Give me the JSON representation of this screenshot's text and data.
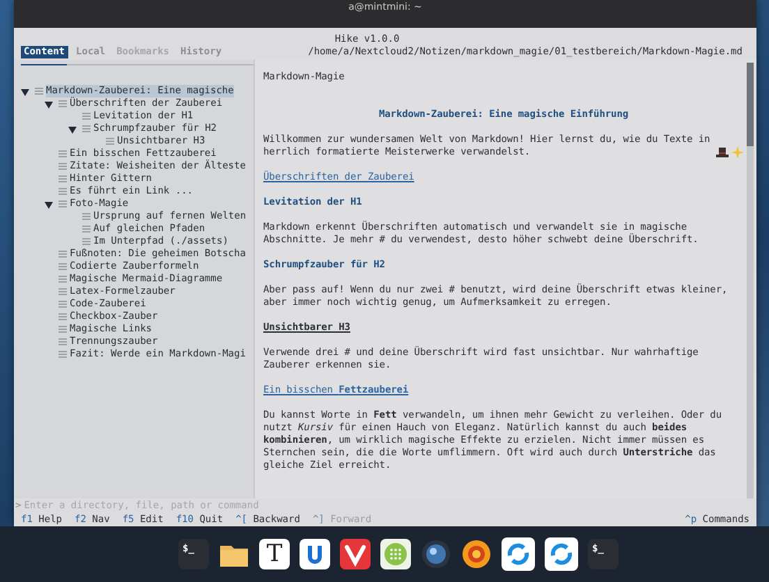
{
  "window": {
    "title": "a@mintmini: ~"
  },
  "app": {
    "name": "Hike v1.0.0",
    "path": "/home/a/Nextcloud2/Notizen/markdown_magie/01_testbereich/Markdown-Magie.md"
  },
  "tabs": [
    {
      "label": "Content",
      "selected": true,
      "disabled": false
    },
    {
      "label": "Local",
      "selected": false,
      "disabled": false
    },
    {
      "label": "Bookmarks",
      "selected": false,
      "disabled": true
    },
    {
      "label": "History",
      "selected": false,
      "disabled": false
    }
  ],
  "outline": [
    {
      "label": "Markdown-Zauberei: Eine magische",
      "selected": true,
      "expanded": true,
      "children": [
        {
          "label": "Überschriften der Zauberei",
          "selected": false,
          "expanded": true,
          "children": [
            {
              "label": "Levitation der H1",
              "selected": false
            },
            {
              "label": "Schrumpfzauber für H2",
              "selected": false,
              "expanded": true,
              "children": [
                {
                  "label": "Unsichtbarer H3",
                  "selected": false
                }
              ]
            }
          ]
        },
        {
          "label": "Ein bisschen Fettzauberei",
          "selected": false
        },
        {
          "label": "Zitate: Weisheiten der Älteste",
          "selected": false
        },
        {
          "label": "Hinter Gittern",
          "selected": false
        },
        {
          "label": "Es führt ein Link ...",
          "selected": false
        },
        {
          "label": "Foto-Magie",
          "selected": false,
          "expanded": true,
          "children": [
            {
              "label": "Ursprung auf fernen Welten",
              "selected": false
            },
            {
              "label": "Auf gleichen Pfaden",
              "selected": false
            },
            {
              "label": "Im Unterpfad (./assets)",
              "selected": false
            }
          ]
        },
        {
          "label": "Fußnoten: Die geheimen Botscha",
          "selected": false
        },
        {
          "label": "Codierte Zauberformeln",
          "selected": false
        },
        {
          "label": "Magische Mermaid-Diagramme",
          "selected": false
        },
        {
          "label": "Latex-Formelzauber",
          "selected": false
        },
        {
          "label": "Code-Zauberei",
          "selected": false
        },
        {
          "label": "Checkbox-Zauber",
          "selected": false
        },
        {
          "label": "Magische Links",
          "selected": false
        },
        {
          "label": "Trennungszauber",
          "selected": false
        },
        {
          "label": "Fazit: Werde ein Markdown-Magi",
          "selected": false
        }
      ]
    }
  ],
  "document": [
    {
      "kind": "filename",
      "text": "Markdown-Magie"
    },
    {
      "kind": "h1",
      "text": "Markdown-Zauberei: Eine magische Einführung"
    },
    {
      "kind": "intro",
      "text": "Willkommen zur wundersamen Welt von Markdown! Hier lernst du, wie du Texte in herrlich formatierte Meisterwerke verwandelst."
    },
    {
      "kind": "h2",
      "text": "Überschriften der Zauberei"
    },
    {
      "kind": "h3",
      "text": "Levitation der H1"
    },
    {
      "kind": "paragraph",
      "text": "Markdown erkennt Überschriften automatisch und verwandelt sie in magische Abschnitte. Je mehr # du verwendest, desto höher schwebt deine Überschrift."
    },
    {
      "kind": "h3",
      "text": "Schrumpfzauber für H2"
    },
    {
      "kind": "paragraph",
      "text": "Aber pass auf! Wenn du nur zwei # benutzt, wird deine Überschrift etwas kleiner, aber immer noch wichtig genug, um Aufmerksamkeit zu erregen."
    },
    {
      "kind": "h4",
      "text": "Unsichtbarer H3"
    },
    {
      "kind": "paragraph",
      "text": "Verwende drei # und deine Überschrift wird fast unsichtbar. Nur wahrhaftige Zauberer erkennen sie."
    },
    {
      "kind": "h2",
      "text": "Ein bisschen **Fettzauberei**"
    },
    {
      "kind": "paragraph",
      "text": "Du kannst Worte in **Fett** verwandeln, um ihnen mehr Gewicht zu verleihen. Oder du nutzt *Kursiv* für einen Hauch von Eleganz. Natürlich kannst du auch **beides kombinieren**, um wirklich magische Effekte zu erzielen. Nicht immer müssen es Sternchen sein, die die Worte umflimmern. Oft wird auch durch **Unterstriche** das gleiche Ziel erreicht."
    }
  ],
  "command": {
    "prompt": ">",
    "placeholder": "Enter a directory, file, path or command"
  },
  "keys": [
    {
      "key": "f1",
      "label": "Help",
      "disabled": false
    },
    {
      "key": "f2",
      "label": "Nav",
      "disabled": false
    },
    {
      "key": "f5",
      "label": "Edit",
      "disabled": false
    },
    {
      "key": "f10",
      "label": "Quit",
      "disabled": false
    },
    {
      "key": "^[",
      "label": "Backward",
      "disabled": false
    },
    {
      "key": "^]",
      "label": "Forward",
      "disabled": true
    }
  ],
  "keys_right": [
    {
      "key": "^p",
      "label": "Commands",
      "disabled": false
    }
  ],
  "dock": [
    {
      "kind": "terminal",
      "glyph": "$_"
    },
    {
      "kind": "folder"
    },
    {
      "kind": "letter",
      "glyph": "T"
    },
    {
      "kind": "u-app"
    },
    {
      "kind": "vivaldi"
    },
    {
      "kind": "grid"
    },
    {
      "kind": "lens"
    },
    {
      "kind": "flower"
    },
    {
      "kind": "sync"
    },
    {
      "kind": "sync"
    },
    {
      "kind": "terminal",
      "glyph": "$_"
    }
  ]
}
